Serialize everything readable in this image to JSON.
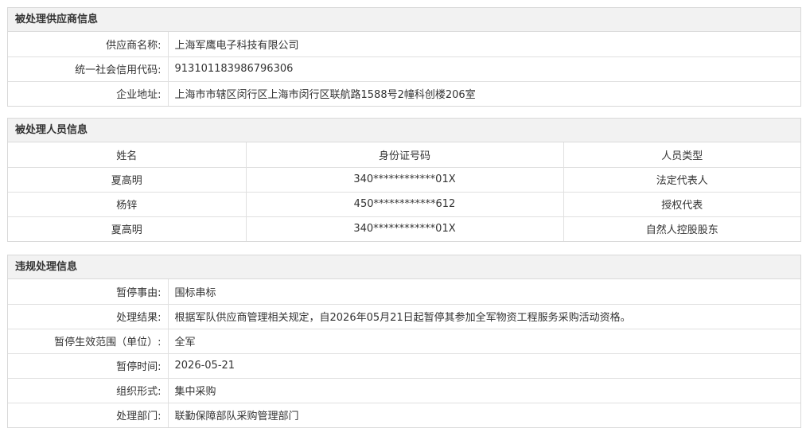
{
  "supplier": {
    "title": "被处理供应商信息",
    "rows": [
      {
        "label": "供应商名称:",
        "value": "上海军鹰电子科技有限公司"
      },
      {
        "label": "统一社会信用代码:",
        "value": "913101183986796306"
      },
      {
        "label": "企业地址:",
        "value": "上海市市辖区闵行区上海市闵行区联航路1588号2幢科创楼206室"
      }
    ]
  },
  "personnel": {
    "title": "被处理人员信息",
    "headers": [
      "姓名",
      "身份证号码",
      "人员类型"
    ],
    "rows": [
      [
        "夏高明",
        "340************01X",
        "法定代表人"
      ],
      [
        "杨锌",
        "450************612",
        "授权代表"
      ],
      [
        "夏高明",
        "340************01X",
        "自然人控股股东"
      ]
    ]
  },
  "violation": {
    "title": "违规处理信息",
    "rows": [
      {
        "label": "暂停事由:",
        "value": "围标串标"
      },
      {
        "label": "处理结果:",
        "value": "根据军队供应商管理相关规定，自2026年05月21日起暂停其参加全军物资工程服务采购活动资格。"
      },
      {
        "label": "暂停生效范围（单位）:",
        "value": "全军"
      },
      {
        "label": "暂停时间:",
        "value": "2026-05-21"
      },
      {
        "label": "组织形式:",
        "value": "集中采购"
      },
      {
        "label": "处理部门:",
        "value": "联勤保障部队采购管理部门"
      }
    ]
  }
}
